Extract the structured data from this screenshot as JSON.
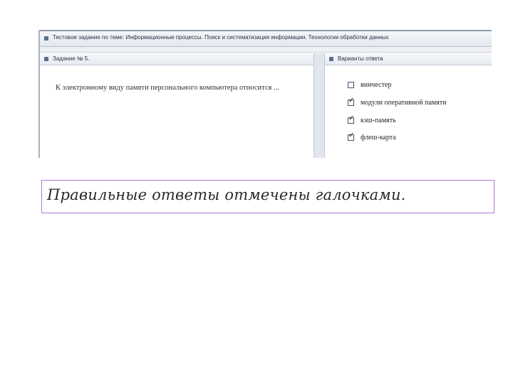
{
  "window": {
    "title_bar": "Тестовое задание по теме: Информационные процессы. Поиск и систематизация информации. Технологии обработки данных"
  },
  "question_panel": {
    "header": "Задание № 5.",
    "question_text": "К электронному виду памяти персонального компьютера относится ..."
  },
  "answers_panel": {
    "header": "Варианты ответа",
    "options": [
      {
        "label": "винчестер",
        "checked": false
      },
      {
        "label": "модули оперативной памяти",
        "checked": true
      },
      {
        "label": "кэш-память",
        "checked": true
      },
      {
        "label": "флеш-карта",
        "checked": true
      }
    ]
  },
  "caption": {
    "text": "Правильные ответы отмечены галочками."
  }
}
